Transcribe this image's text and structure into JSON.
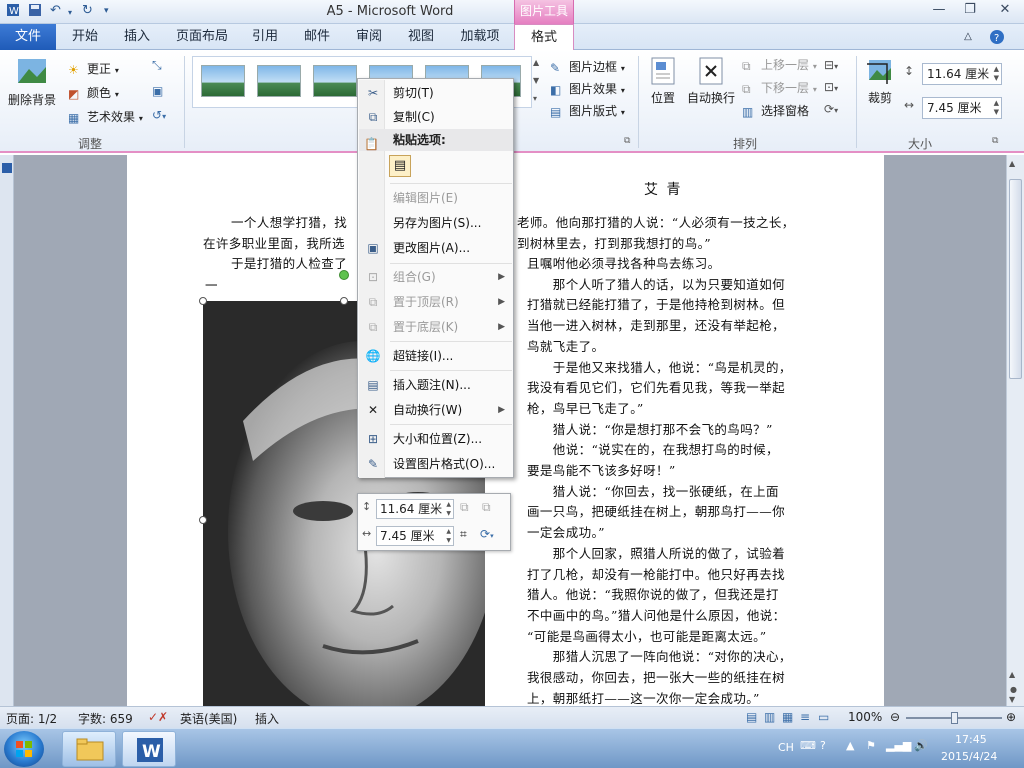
{
  "window": {
    "title": "A5 - Microsoft Word",
    "picture_tools_tag": "图片工具"
  },
  "tabs": [
    "文件",
    "开始",
    "插入",
    "页面布局",
    "引用",
    "邮件",
    "审阅",
    "视图",
    "加载项",
    "格式"
  ],
  "ribbon": {
    "adjust": {
      "remove_bg": "删除背景",
      "corrections": "更正",
      "color": "颜色",
      "artistic": "艺术效果",
      "group_label": "调整"
    },
    "styles": {
      "border": "图片边框",
      "effects": "图片效果",
      "layout": "图片版式"
    },
    "arrange": {
      "position": "位置",
      "wrap": "自动换行",
      "bring_forward": "上移一层",
      "send_backward": "下移一层",
      "selection_pane": "选择窗格",
      "group_label": "排列"
    },
    "size": {
      "crop": "裁剪",
      "height": "11.64 厘米",
      "width": "7.45 厘米",
      "group_label": "大小"
    }
  },
  "document": {
    "heading": "艾  青",
    "lines_full": [
      "一个人想学打猎，找",
      "在许多职业里面，我所选",
      "于是打猎的人检查了"
    ],
    "first_right": "老师。他向那打猎的人说：“人必须有一技之长，",
    "second_right": "到树林里去，打到那我想打的鸟。”",
    "dash": "一",
    "right_column": [
      "且嘱咐他必须寻找各种鸟去练习。",
      "　　那个人听了猎人的话，以为只要知道如何",
      "打猎就已经能打猎了，于是他持枪到树林。但",
      "当他一进入树林，走到那里，还没有举起枪，",
      "鸟就飞走了。",
      "　　于是他又来找猎人，他说：“鸟是机灵的，",
      "我没有看见它们，它们先看见我，等我一举起",
      "枪，鸟早已飞走了。”",
      "　　猎人说：“你是想打那不会飞的鸟吗？”",
      "　　他说：“说实在的，在我想打鸟的时候，",
      "要是鸟能不飞该多好呀！”",
      "　　猎人说：“你回去，找一张硬纸，在上面",
      "画一只鸟，把硬纸挂在树上，朝那鸟打——你",
      "一定会成功。”",
      "　　那个人回家，照猎人所说的做了，试验着",
      "打了几枪，却没有一枪能打中。他只好再去找",
      "猎人。他说：“我照你说的做了，但我还是打",
      "不中画中的鸟。”猎人问他是什么原因，他说：",
      "“可能是鸟画得太小，也可能是距离太远。”",
      "　　那猎人沉思了一阵向他说：“对你的决心，",
      "我很感动，你回去，把一张大一些的纸挂在树",
      "上，朝那纸打——这一次你一定会成功。”"
    ]
  },
  "context_menu": {
    "cut": "剪切(T)",
    "copy": "复制(C)",
    "paste_header": "粘贴选项:",
    "edit_picture": "编辑图片(E)",
    "save_as": "另存为图片(S)...",
    "change_picture": "更改图片(A)...",
    "group": "组合(G)",
    "bring_front": "置于顶层(R)",
    "send_back": "置于底层(K)",
    "hyperlink": "超链接(I)...",
    "insert_caption": "插入题注(N)...",
    "wrap_text": "自动换行(W)",
    "size_position": "大小和位置(Z)...",
    "format_picture": "设置图片格式(O)..."
  },
  "mini_toolbar": {
    "height": "11.64 厘米",
    "width": "7.45 厘米"
  },
  "statusbar": {
    "page": "页面: 1/2",
    "words": "字数: 659",
    "language": "英语(美国)",
    "mode": "插入",
    "zoom": "100%"
  },
  "taskbar": {
    "lang": "CH",
    "time": "17:45",
    "date": "2015/4/24"
  }
}
